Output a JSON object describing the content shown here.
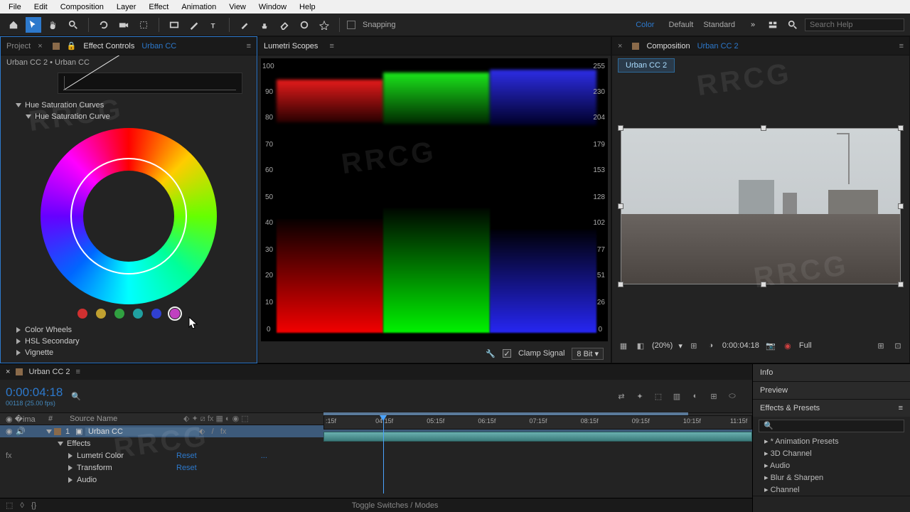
{
  "menu": [
    "File",
    "Edit",
    "Composition",
    "Layer",
    "Effect",
    "Animation",
    "View",
    "Window",
    "Help"
  ],
  "toolbar": {
    "snapping": "Snapping",
    "colorLink": "Color",
    "wsDefault": "Default",
    "wsStandard": "Standard"
  },
  "search": {
    "placeholder": "Search Help"
  },
  "leftPanel": {
    "tabProject": "Project",
    "tabEffect": "Effect Controls",
    "tabEffectLink": "Urban CC",
    "breadcrumb": "Urban CC 2 • Urban CC",
    "hueSat": "Hue Saturation Curves",
    "hueSatCurve": "Hue Saturation Curve",
    "colorWheels": "Color Wheels",
    "hsl": "HSL Secondary",
    "vignette": "Vignette",
    "swatches": [
      "#d03030",
      "#c0a030",
      "#30a040",
      "#20a0a0",
      "#3040d0",
      "#c040c0"
    ]
  },
  "scopes": {
    "title": "Lumetri Scopes",
    "left": [
      "100",
      "90",
      "80",
      "70",
      "60",
      "50",
      "40",
      "30",
      "20",
      "10",
      "0"
    ],
    "right": [
      "255",
      "230",
      "204",
      "179",
      "153",
      "128",
      "102",
      "77",
      "51",
      "26",
      "0"
    ],
    "clamp": "Clamp Signal",
    "bit": "8 Bit"
  },
  "rightPanel": {
    "tabComp": "Composition",
    "tabCompLink": "Urban CC 2",
    "compTab": "Urban CC 2",
    "zoom": "(20%)",
    "tc": "0:00:04:18",
    "res": "Full"
  },
  "timeline": {
    "tab": "Urban CC 2",
    "tc": "0:00:04:18",
    "fps": "00118 (25.00 fps)",
    "colNum": "#",
    "colSource": "Source Name",
    "layerNum": "1",
    "layerName": "Urban CC",
    "effects": "Effects",
    "lumetri": "Lumetri Color",
    "transform": "Transform",
    "audio": "Audio",
    "reset": "Reset",
    "dots": "...",
    "toggle": "Toggle Switches / Modes",
    "ticks": [
      ":15f",
      "04:15f",
      "05:15f",
      "06:15f",
      "07:15f",
      "08:15f",
      "09:15f",
      "10:15f",
      "11:15f"
    ]
  },
  "side": {
    "info": "Info",
    "preview": "Preview",
    "ep": "Effects & Presets",
    "items": [
      "* Animation Presets",
      "3D Channel",
      "Audio",
      "Blur & Sharpen",
      "Channel"
    ]
  },
  "chart_data": {
    "type": "other",
    "description": "RGB Parade waveform scope",
    "channels": [
      "R",
      "G",
      "B"
    ],
    "left_scale": {
      "min": 0,
      "max": 100,
      "step": 10,
      "unit": "IRE"
    },
    "right_scale": {
      "min": 0,
      "max": 255,
      "approx_ticks": [
        0,
        26,
        51,
        77,
        102,
        128,
        153,
        179,
        204,
        230,
        255
      ]
    },
    "observations": {
      "R": {
        "concentration_low": [
          0,
          30
        ],
        "concentration_high": [
          80,
          92
        ]
      },
      "G": {
        "concentration_low": [
          0,
          34
        ],
        "concentration_high": [
          82,
          96
        ]
      },
      "B": {
        "concentration_low": [
          0,
          28
        ],
        "concentration_high": [
          84,
          98
        ]
      }
    }
  }
}
